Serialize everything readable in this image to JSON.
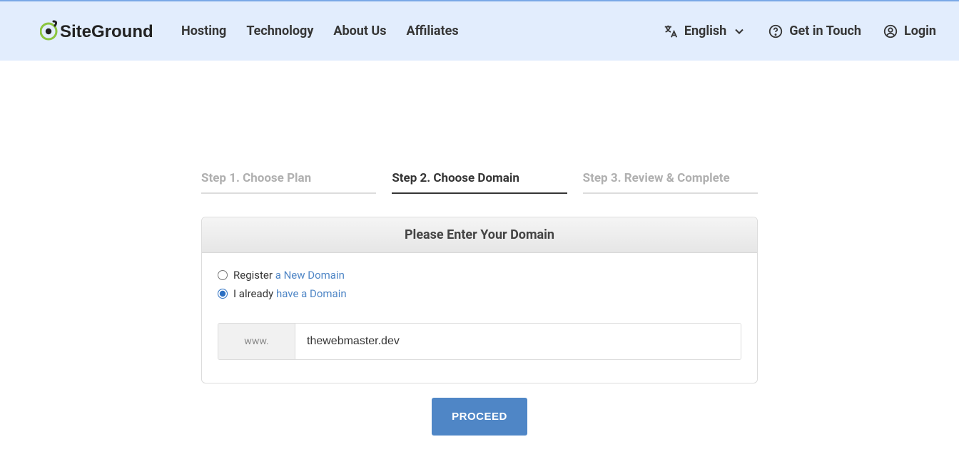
{
  "header": {
    "logo_text": "SiteGround",
    "nav": [
      "Hosting",
      "Technology",
      "About Us",
      "Affiliates"
    ],
    "language_label": "English",
    "get_in_touch": "Get in Touch",
    "login": "Login"
  },
  "steps": [
    {
      "label": "Step 1. Choose Plan",
      "active": false
    },
    {
      "label": "Step 2. Choose Domain",
      "active": true
    },
    {
      "label": "Step 3. Review & Complete",
      "active": false
    }
  ],
  "card": {
    "title": "Please Enter Your Domain",
    "options": {
      "register_prefix": "Register",
      "register_link": "a New Domain",
      "existing_prefix": "I already",
      "existing_link": "have a Domain",
      "selected": "existing"
    },
    "www_label": "www.",
    "domain_value": "thewebmaster.dev"
  },
  "proceed_label": "PROCEED"
}
